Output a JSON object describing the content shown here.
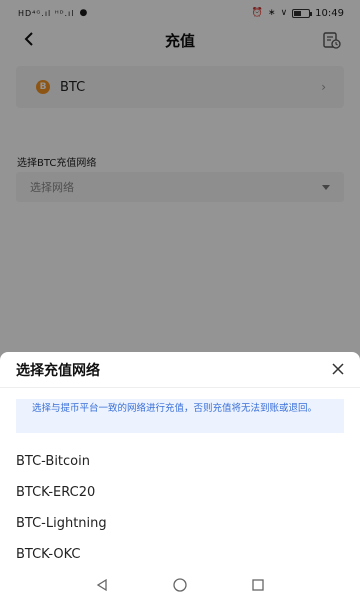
{
  "status_bar": {
    "left": "℡⁴ᴳ‧∧‧∧ᴳ",
    "time": "10:49",
    "battery_level": 0.4
  },
  "header": {
    "title": "充值"
  },
  "coin": {
    "symbol": "B",
    "name": "BTC",
    "accent": "#f39323"
  },
  "network": {
    "label": "选择BTC充值网络",
    "placeholder": "选择网络"
  },
  "sheet": {
    "title": "选择充值网络",
    "notice": "选择与提币平台一致的网络进行充值，否则充值将无法到账或退回。",
    "networks": [
      "BTC-Bitcoin",
      "BTCK-ERC20",
      "BTC-Lightning",
      "BTCK-OKC"
    ]
  },
  "colors": {
    "notice_bg": "#ecf3fe",
    "notice_text": "#3a6fd8"
  }
}
